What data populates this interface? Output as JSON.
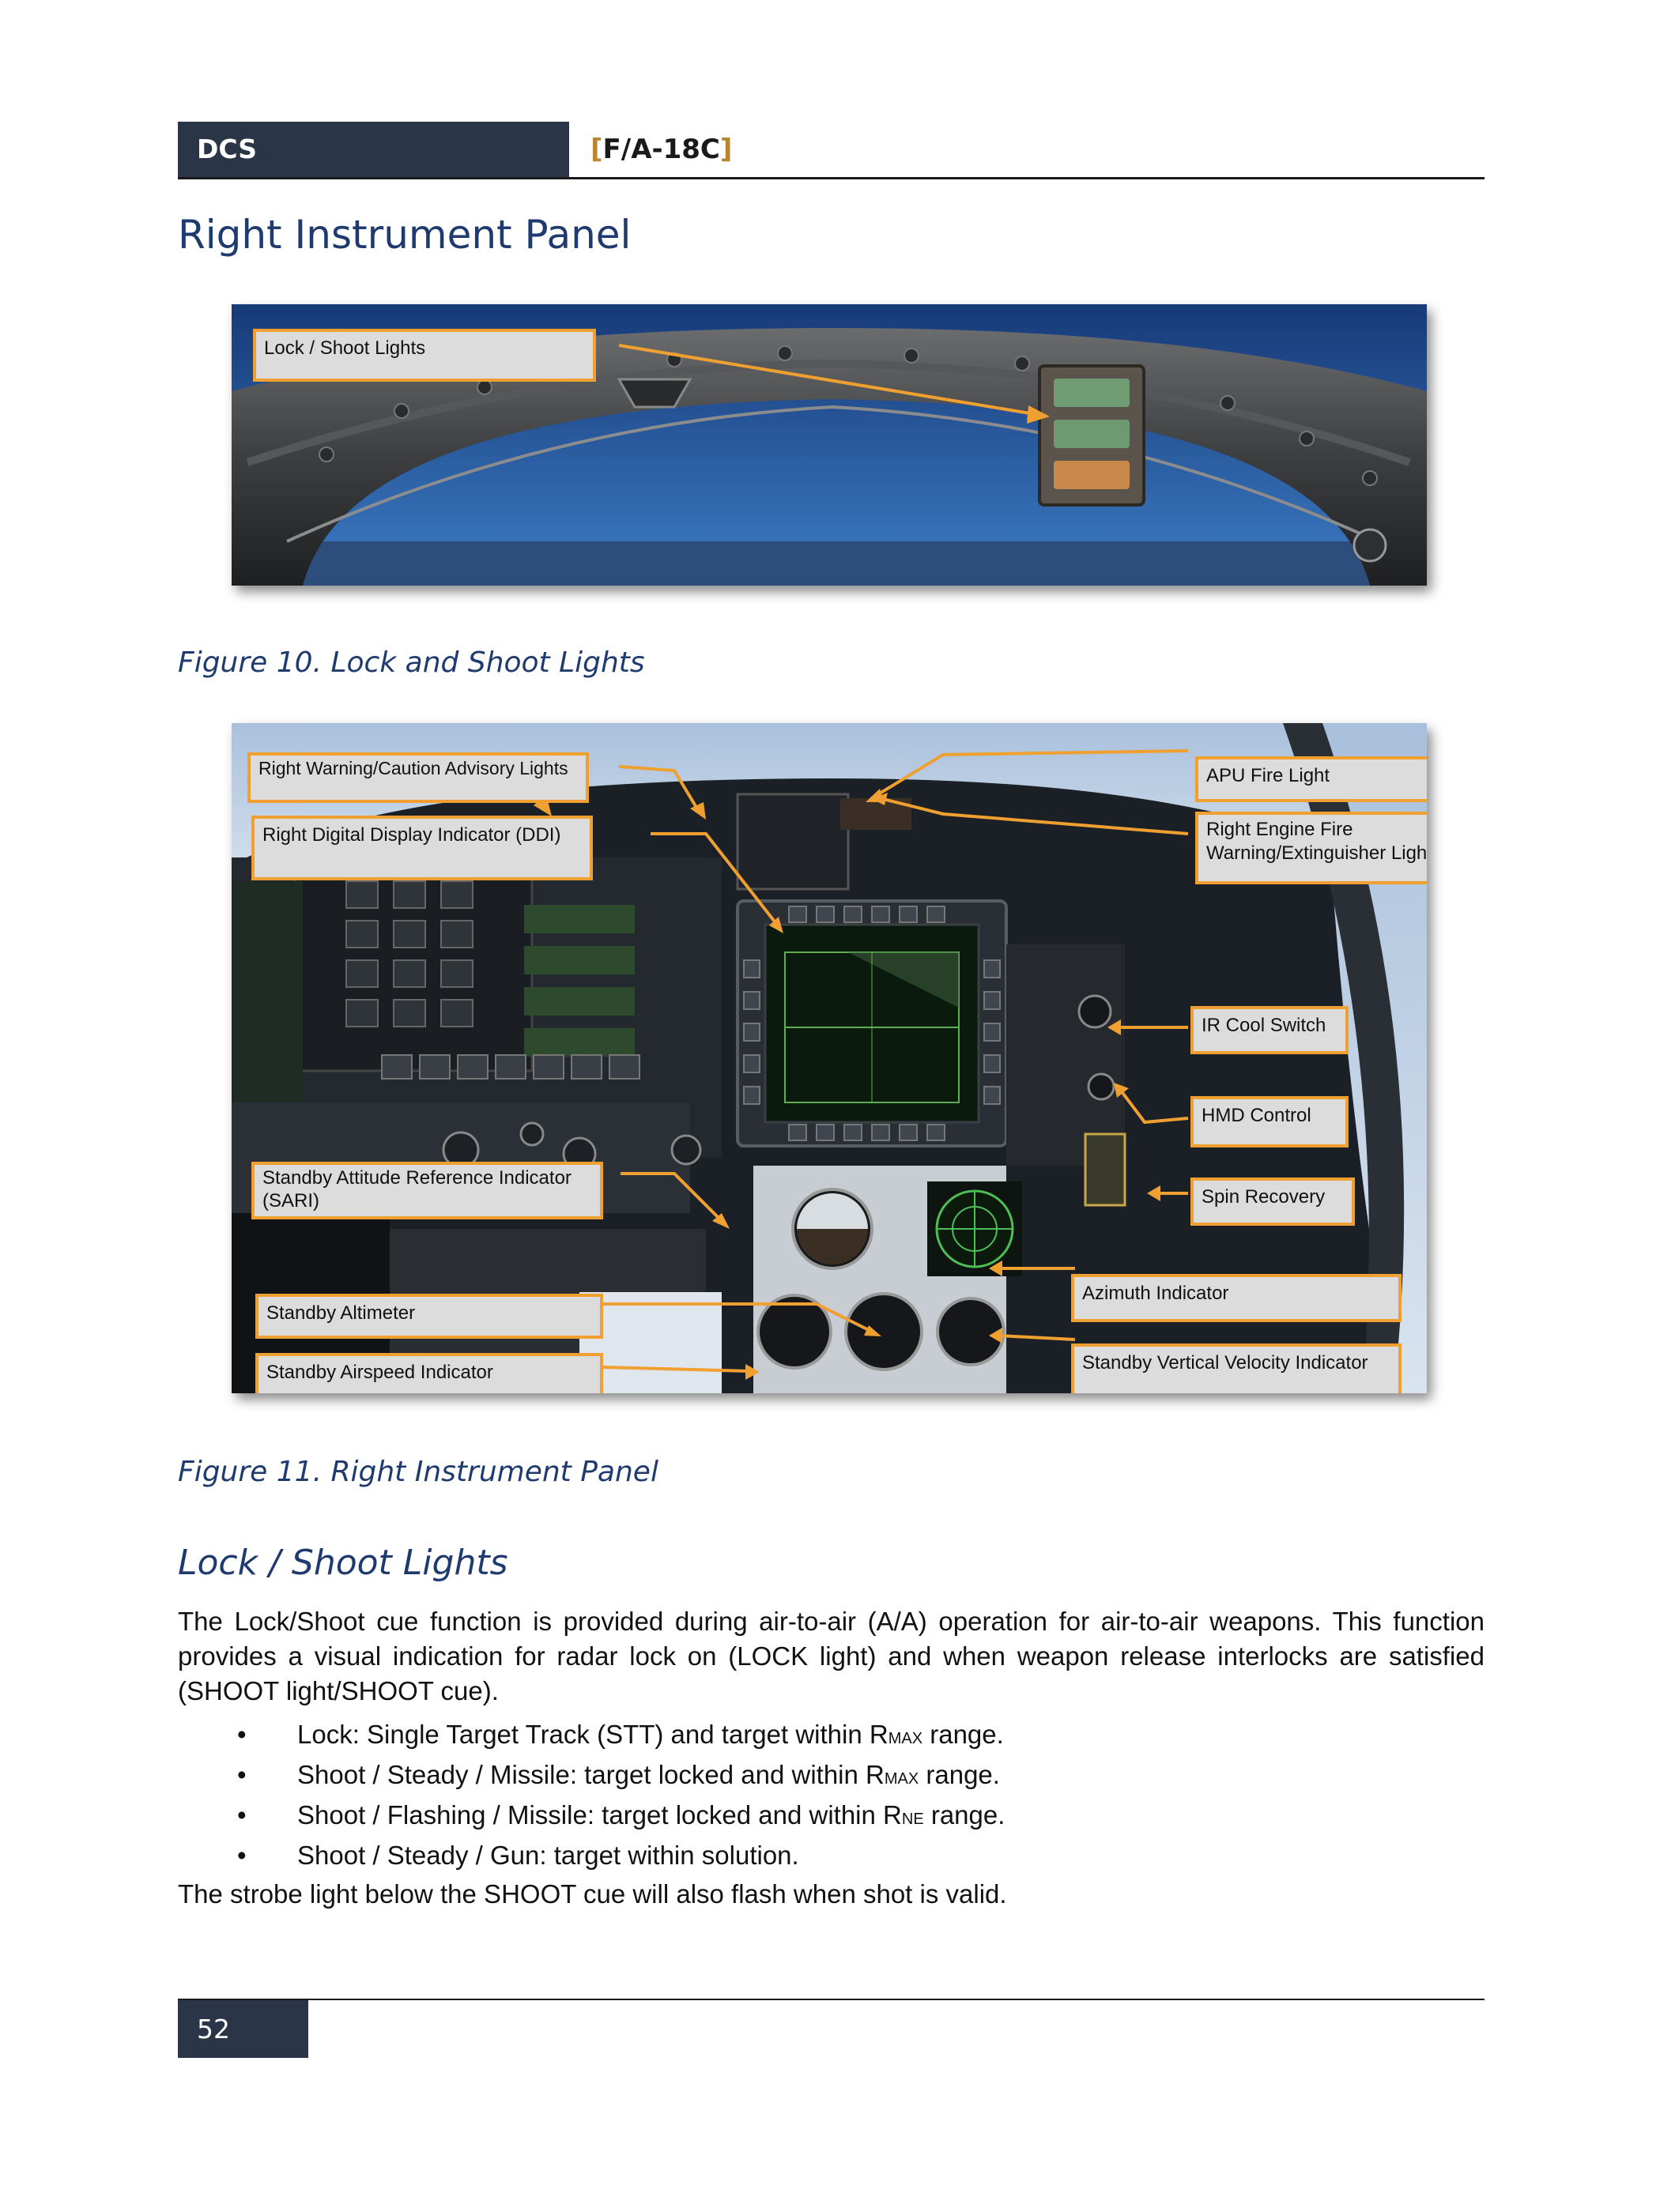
{
  "header": {
    "left": "DCS",
    "right": "F/A-18C",
    "bracket_color": "#b8862e",
    "bar_color": "#2a3547"
  },
  "page_title": "Right Instrument Panel",
  "figure10": {
    "caption": "Figure 10. Lock and Shoot Lights",
    "callouts": {
      "lock_shoot": "Lock / Shoot Lights"
    }
  },
  "figure11": {
    "caption": "Figure 11. Right Instrument Panel",
    "callouts": {
      "right_warning": "Right Warning/Caution Advisory Lights",
      "right_ddi": "Right Digital Display Indicator (DDI)",
      "sari": "Standby Attitude Reference Indicator (SARI)",
      "altimeter": "Standby Altimeter",
      "airspeed": "Standby Airspeed Indicator",
      "apu_fire": "APU Fire Light",
      "engine_fire": "Right Engine Fire Warning/Extinguisher Lights",
      "ir_cool": "IR Cool Switch",
      "hmd": "HMD Control",
      "spin": "Spin Recovery",
      "azimuth": "Azimuth Indicator",
      "vvi": "Standby Vertical Velocity Indicator"
    },
    "callout_border_color": "#f0a030"
  },
  "section": {
    "heading": "Lock / Shoot Lights",
    "intro": "The Lock/Shoot cue function is provided during air-to-air (A/A) operation for air-to-air weapons. This function provides a visual indication for radar lock on (LOCK light) and when weapon release interlocks are satisfied (SHOOT light/SHOOT cue).",
    "bullets": [
      {
        "pre": "Lock: Single Target Track (STT) and target within R",
        "sub": "MAX",
        "post": " range."
      },
      {
        "pre": "Shoot / Steady / Missile: target locked and within R",
        "sub": "MAX",
        "post": " range."
      },
      {
        "pre": "Shoot / Flashing / Missile: target locked and within R",
        "sub": "NE",
        "post": " range."
      },
      {
        "pre": "Shoot / Steady / Gun: target within solution.",
        "sub": "",
        "post": ""
      }
    ],
    "outro": "The strobe light below the SHOOT cue will also flash when shot is valid."
  },
  "footer": {
    "page_number": "52"
  }
}
